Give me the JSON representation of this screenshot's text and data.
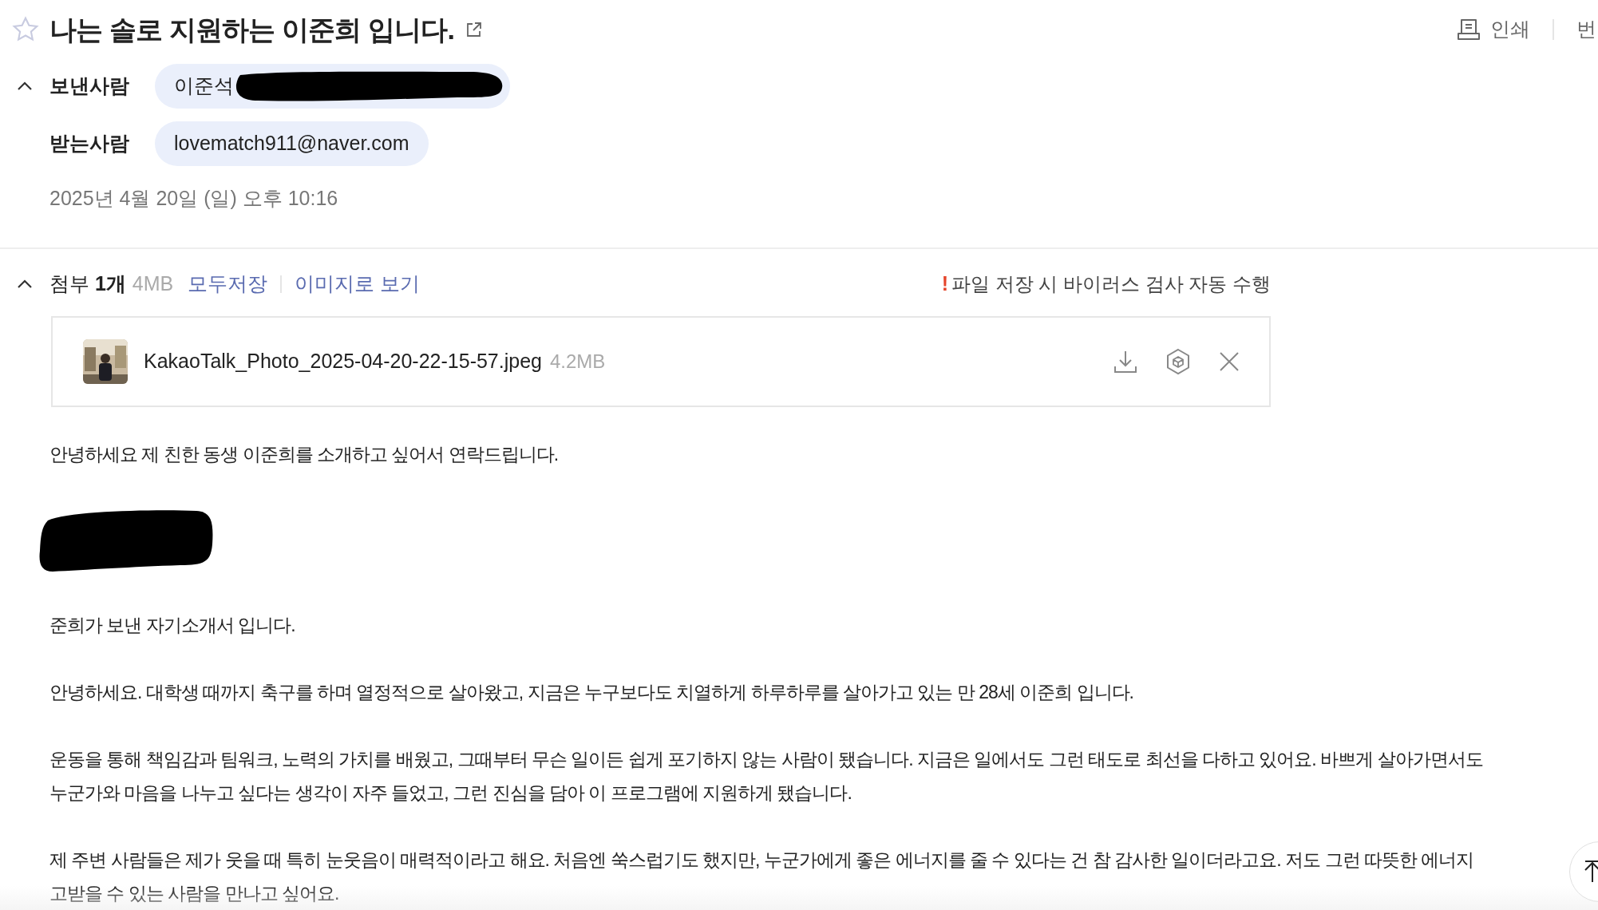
{
  "subject": {
    "title": "나는 솔로 지원하는 이준희 입니다.",
    "starred": false
  },
  "toolbar": [
    "인쇄",
    "번"
  ],
  "sender": {
    "label": "보낸사람",
    "value": "이준석",
    "expanded": true
  },
  "recipient": {
    "label": "받는사람",
    "value": "lovematch911@naver.com"
  },
  "date": "2025년 4월 20일 (일) 오후 10:16",
  "attachments": {
    "label": "첨부",
    "count": "1개",
    "size": "4MB",
    "expanded": true,
    "actions": [
      "모두저장",
      "이미지로 보기"
    ],
    "notice_mark": "!",
    "notice": "파일 저장 시 바이러스 검사 자동 수행",
    "files": [
      {
        "name": "KakaoTalk_Photo_2025-04-20-22-15-57.jpeg",
        "size": "4.2MB"
      }
    ]
  },
  "body": [
    {
      "kind": "text",
      "lines": [
        "안녕하세요 제 친한 동생 이준희를 소개하고 싶어서 연락드립니다."
      ]
    },
    {
      "kind": "redacted"
    },
    {
      "kind": "text",
      "lines": [
        "준희가 보낸 자기소개서 입니다."
      ]
    },
    {
      "kind": "text",
      "lines": [
        "안녕하세요. 대학생 때까지 축구를 하며 열정적으로 살아왔고, 지금은 누구보다도 치열하게 하루하루를 살아가고 있는 만 28세 이준희 입니다."
      ]
    },
    {
      "kind": "text",
      "lines": [
        "운동을 통해 책임감과 팀워크, 노력의 가치를 배웠고, 그때부터 무슨 일이든 쉽게 포기하지 않는 사람이 됐습니다. 지금은 일에서도 그런 태도로 최선을 다하고 있어요. 바쁘게 살아가면서도",
        "누군가와 마음을 나누고 싶다는 생각이 자주 들었고, 그런 진심을 담아 이 프로그램에 지원하게 됐습니다."
      ]
    },
    {
      "kind": "text",
      "lines": [
        "제 주변 사람들은 제가 웃을 때 특히 눈웃음이 매력적이라고 해요. 처음엔 쑥스럽기도 했지만, 누군가에게 좋은 에너지를 줄 수 있다는 건 참 감사한 일이더라고요. 저도 그런 따뜻한 에너지",
        "고받을 수 있는 사람을 만나고 싶어요."
      ]
    }
  ]
}
